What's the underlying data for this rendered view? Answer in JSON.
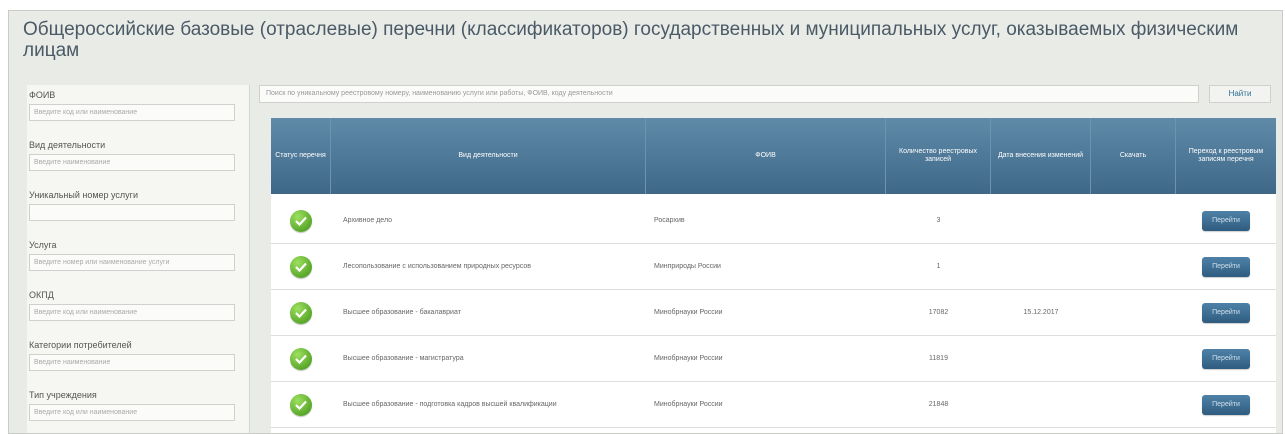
{
  "title": "Общероссийские базовые (отраслевые) перечни (классификаторов) государственных и муниципальных услуг, оказываемых физическим лицам",
  "filters": [
    {
      "label": "ФОИВ",
      "placeholder": "Введите код или наименование"
    },
    {
      "label": "Вид деятельности",
      "placeholder": "Введите наименование"
    },
    {
      "label": "Уникальный номер услуги",
      "placeholder": ""
    },
    {
      "label": "Услуга",
      "placeholder": "Введите номер или наименование услуги"
    },
    {
      "label": "ОКПД",
      "placeholder": "Введите код или наименование"
    },
    {
      "label": "Категории потребителей",
      "placeholder": "Введите наименование"
    },
    {
      "label": "Тип учреждения",
      "placeholder": "Введите код или наименование"
    }
  ],
  "search": {
    "placeholder": "Поиск по уникальному реестровому номеру, наименованию услуги или работы, ФОИВ, коду деятельности",
    "button": "Найти"
  },
  "table": {
    "headers": {
      "status": "Статус перечня",
      "activity": "Вид деятельности",
      "foiv": "ФОИВ",
      "count": "Количество реестровых записей",
      "date": "Дата внесения изменений",
      "download": "Скачать",
      "goto": "Переход к реестровым записям перечня"
    },
    "rows": [
      {
        "activity": "Архивное дело",
        "foiv": "Росархив",
        "count": "3",
        "date": "",
        "button": "Перейти"
      },
      {
        "activity": "Лесопользование с использованием природных ресурсов",
        "foiv": "Минприроды России",
        "count": "1",
        "date": "",
        "button": "Перейти"
      },
      {
        "activity": "Высшее образование - бакалавриат",
        "foiv": "Минобрнауки России",
        "count": "17082",
        "date": "15.12.2017",
        "button": "Перейти"
      },
      {
        "activity": "Высшее образование - магистратура",
        "foiv": "Минобрнауки России",
        "count": "11819",
        "date": "",
        "button": "Перейти"
      },
      {
        "activity": "Высшее образование - подготовка кадров высшей квалификации",
        "foiv": "Минобрнауки России",
        "count": "21848",
        "date": "",
        "button": "Перейти"
      }
    ]
  },
  "colors": {
    "header_bg": "#4f7b9c",
    "status_ok": "#6cb33f",
    "button_bg": "#3a6a8f"
  }
}
